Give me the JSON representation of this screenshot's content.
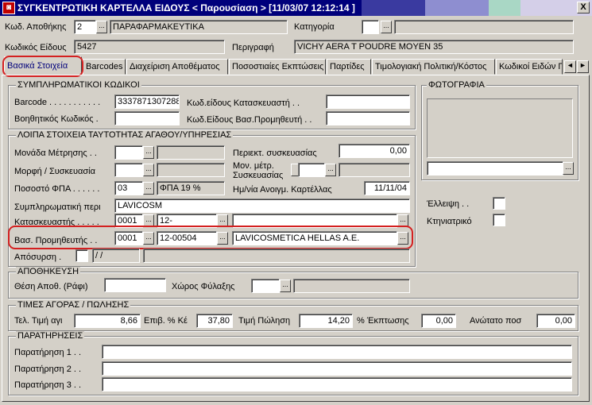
{
  "window": {
    "title": "ΣΥΓΚΕΝΤΡΩΤΙΚΗ ΚΑΡΤΕΛΛΑ ΕΙΔΟΥΣ  < Παρουσίαση >   [11/03/07 12:12:14 ]",
    "close_label": "X"
  },
  "header": {
    "warehouse_code_label": "Κωδ. Αποθήκης",
    "warehouse_code_value": "2",
    "warehouse_name_value": "ΠΑΡΑΦΑΡΜΑΚΕΥΤΙΚΑ",
    "category_label": "Κατηγορία",
    "item_code_label": "Κωδικός Είδους",
    "item_code_value": "5427",
    "description_label": "Περιγραφή",
    "description_value": "VICHY AERA T POUDRE MOYEN 35"
  },
  "tabs": [
    {
      "label": "Βασικά Στοιχεία"
    },
    {
      "label": "Barcodes"
    },
    {
      "label": "Διαχείριση Αποθέματος"
    },
    {
      "label": "Ποσοστιαίες Εκπτώσεις"
    },
    {
      "label": "Παρτίδες"
    },
    {
      "label": "Τιμολογιακή Πολιτική/Κόστος"
    },
    {
      "label": "Κωδικοί Ειδών Π"
    }
  ],
  "tab_scroll": {
    "left": "◄",
    "right": "►"
  },
  "supplementary": {
    "title": "ΣΥΜΠΛΗΡΩΜΑΤΙΚΟΙ ΚΩΔΙΚΟΙ",
    "barcode_label": "Barcode . . . . . . . . . . .",
    "barcode_value": "3337871307288",
    "aux_code_label": "Βοηθητικός Κωδικός .",
    "manufacturer_code_label": "Κωδ.είδους Κατασκευαστή . .",
    "supplier_code_label": "Κωδ.Είδους Βασ.Προμηθευτή . ."
  },
  "photo": {
    "title": "ΦΩΤΟΓΡΑΦΙΑ"
  },
  "identity": {
    "title": "ΛΟΙΠΑ ΣΤΟΙΧΕΙΑ ΤΑΥΤΟΤΗΤΑΣ ΑΓΑΘΟΥ/ΥΠΗΡΕΣΙΑΣ",
    "unit_label": "Μονάδα Μέτρησης . .",
    "package_content_label": "Περιεκτ. συσκευασίας",
    "package_content_value": "0,00",
    "form_label": "Μορφή / Συσκευασία",
    "package_unit_label_1": "Μον. μέτρ.",
    "package_unit_label_2": "Συσκευασίας",
    "vat_label": "Ποσοστό ΦΠΑ . . . . . .",
    "vat_code_value": "03",
    "vat_desc_value": "ΦΠΑ 19 %",
    "card_open_date_label": "Ημ/νία Ανοιγμ. Καρτέλλας",
    "card_open_date_value": "11/11/04",
    "compl_label": "Συμπληρωματική περι",
    "compl_value": "LAVICOSM",
    "manufacturer_label": "Κατασκευαστής . . . . .",
    "manufacturer_code": "0001",
    "manufacturer_sub": "12-",
    "supplier_label": "Βασ. Προμηθευτής . .",
    "supplier_code": "0001",
    "supplier_sub": "12-00504",
    "supplier_name": "LAVICOSMETICA HELLAS A.E.",
    "withdrawal_label": "Απόσυρση .",
    "withdrawal_date": "/ /",
    "shortage_label": "Έλλειψη . .",
    "veterinary_label": "Κτηνιατρικό"
  },
  "storage": {
    "title": "ΑΠΟΘΗΚΕΥΣΗ",
    "shelf_label": "Θέση Αποθ. (Ράφι)",
    "storage_space_label": "Χώρος Φύλαξης"
  },
  "prices": {
    "title": "ΤΙΜΕΣ ΑΓΟΡΑΣ / ΠΩΛΗΣΗΣ",
    "last_buy_label": "Τελ. Τιμή αγι",
    "last_buy_value": "8,66",
    "markup_label": "Επιβ. % Κέ",
    "markup_value": "37,80",
    "sale_price_label": "Τιμή Πώληση",
    "sale_price_value": "14,20",
    "discount_label": "% Έκπτωσης",
    "discount_value": "0,00",
    "max_qty_label": "Ανώτατο ποσ",
    "max_qty_value": "0,00"
  },
  "notes": {
    "title": "ΠΑΡΑΤΗΡΗΣΕΙΣ",
    "note1_label": "Παρατήρηση 1 . .",
    "note2_label": "Παρατήρηση 2 . .",
    "note3_label": "Παρατήρηση 3 . ."
  },
  "lookup_button_label": "...",
  "colors": {
    "titlebar": "#00007b",
    "window_bg": "#d4d0c8",
    "highlight_oval": "#d42020"
  }
}
